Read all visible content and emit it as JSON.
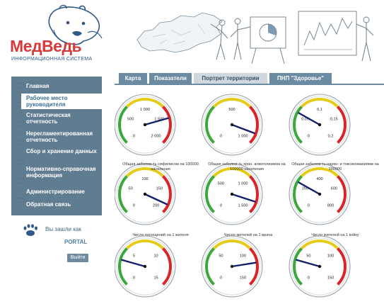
{
  "logo": {
    "title": "МедВедь",
    "subtitle": "ИНФОРМАЦИОННАЯ СИСТЕМА"
  },
  "colors": {
    "sidebar": "#607c91",
    "tab": "#6a8ba2",
    "gauge_green": "#3ca83c",
    "gauge_yellow": "#e6cc1a",
    "gauge_red": "#d8252a",
    "needle": "#14206b"
  },
  "sidebar": {
    "items": [
      {
        "label": "Главная"
      },
      {
        "label": "Рабочее место руководителя"
      },
      {
        "label": "Статистическая отчетность"
      },
      {
        "label": "Нерегламентированная отчетность"
      },
      {
        "label": "Сбор и хранение данных"
      },
      {
        "label": "Нормативно-справочная информация"
      },
      {
        "label": "Администрирование"
      },
      {
        "label": "Обратная связь"
      }
    ]
  },
  "user": {
    "welcome": "Вы зашли как",
    "name": "PORTAL",
    "logout": "Выйти"
  },
  "tabs": [
    {
      "label": "Карта"
    },
    {
      "label": "Показатели"
    },
    {
      "label": "Портрет территории"
    },
    {
      "label": "ПНП \"Здоровье\""
    }
  ],
  "gauges": [
    {
      "ticks": [
        "0",
        "500",
        "1 000",
        "1 500",
        "2 000"
      ],
      "value": 1.55,
      "label": ""
    },
    {
      "ticks": [
        "0",
        "500",
        "1 000"
      ],
      "value": 1.82,
      "label": ""
    },
    {
      "ticks": [
        "0",
        "0,05",
        "0,1",
        "0,15",
        "0,2"
      ],
      "value": 0.55,
      "label": ""
    },
    {
      "ticks": [
        "0",
        "50",
        "100",
        "150",
        "200"
      ],
      "value": 1.85,
      "label": "Общая заболев-ть сифилисом на 100000 населения"
    },
    {
      "ticks": [
        "0",
        "500",
        "1 000",
        "1 500"
      ],
      "value": 1.8,
      "label": "Общая заболев-ть хрон. алкоголизмом на 100000 населения"
    },
    {
      "ticks": [
        "0",
        "200",
        "400",
        "600",
        "800"
      ],
      "value": 0.55,
      "label": "Общая заболев-ть нарко- и токсикоманиями на 100000"
    },
    {
      "ticks": [
        "0",
        "5",
        "10",
        "15"
      ],
      "value": 0.45,
      "label": "Число посещений на 1 жителя"
    },
    {
      "ticks": [
        "0",
        "50",
        "100",
        "150"
      ],
      "value": 1.6,
      "label": "Число жителей на 1 врача"
    },
    {
      "ticks": [
        "0",
        "50",
        "100",
        "150"
      ],
      "value": 0.45,
      "label": "Число жителей на 1 койку"
    }
  ]
}
